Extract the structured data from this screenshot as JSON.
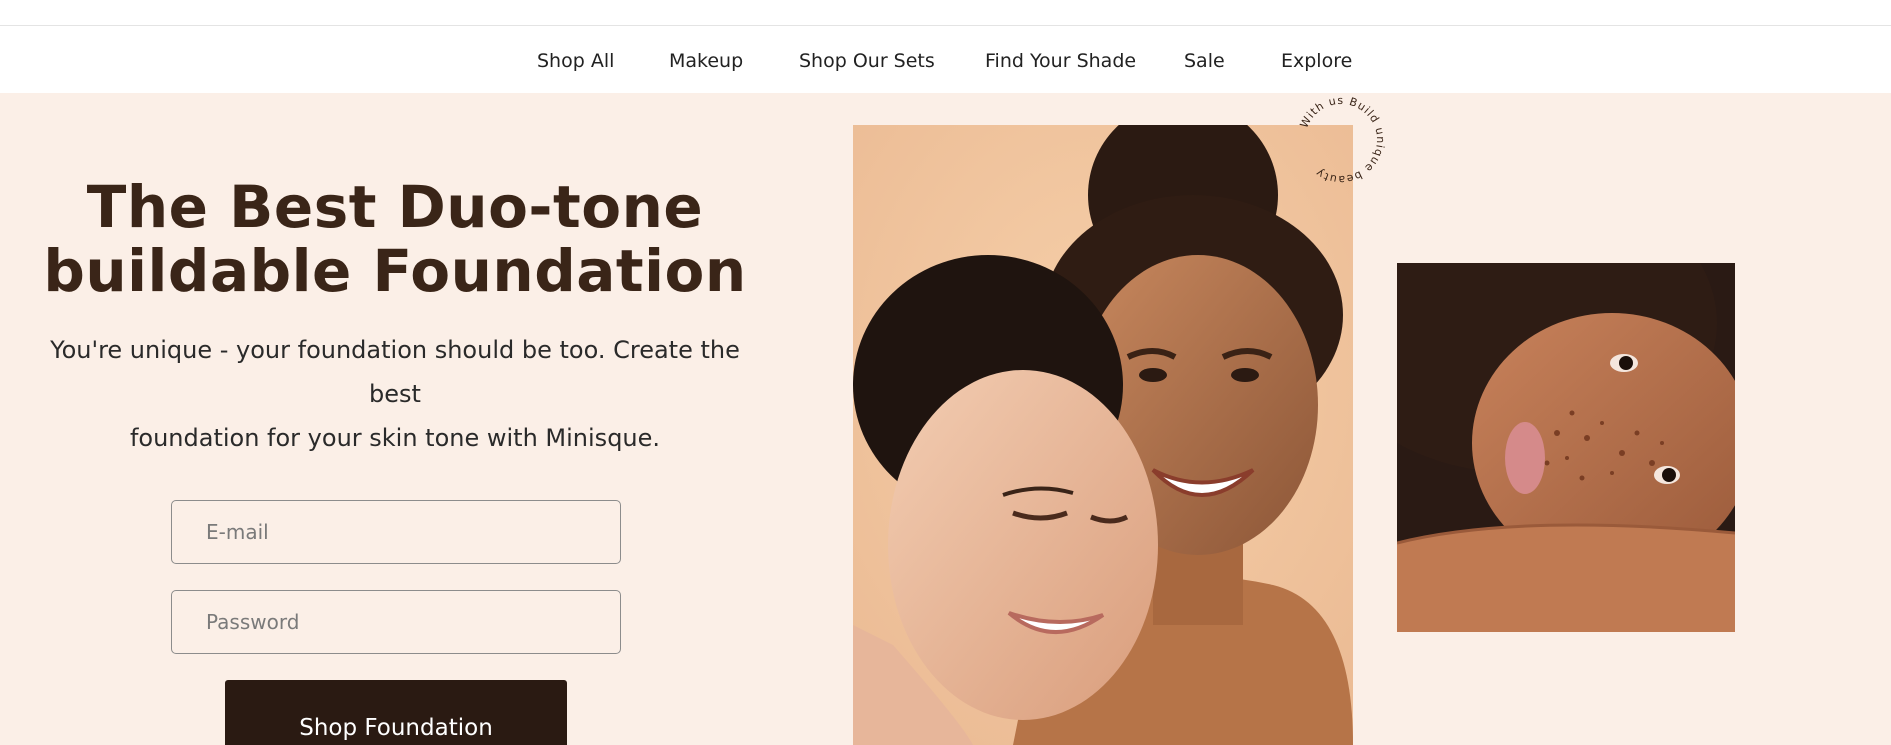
{
  "nav": {
    "items": [
      {
        "label": "Shop All"
      },
      {
        "label": "Makeup"
      },
      {
        "label": "Shop Our Sets"
      },
      {
        "label": "Find Your Shade"
      },
      {
        "label": "Sale"
      },
      {
        "label": "Explore"
      }
    ]
  },
  "hero": {
    "headline_line1": "The Best Duo-tone",
    "headline_line2": "buildable Foundation",
    "subtext_line1": "You're unique - your foundation should be too. Create the best",
    "subtext_line2": "foundation for your skin tone with Minisque.",
    "email_placeholder": "E-mail",
    "password_placeholder": "Password",
    "cta_label": "Shop Foundation",
    "badge_text": "With us Build unique beauty"
  },
  "colors": {
    "hero_background": "#fbefe7",
    "headline": "#3a2518",
    "cta_background": "#2a1a12",
    "cta_text": "#ffffff"
  }
}
